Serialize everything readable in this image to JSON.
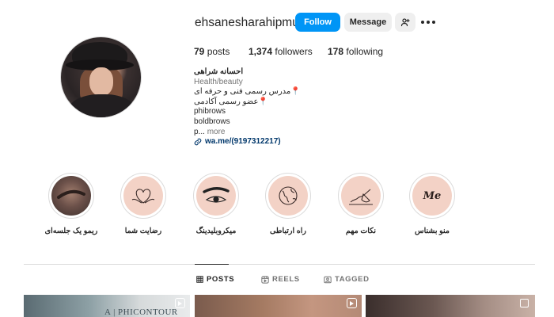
{
  "profile": {
    "username": "ehsanesharahipmu",
    "follow_label": "Follow",
    "message_label": "Message",
    "stats": {
      "posts_count": "79",
      "posts_label": "posts",
      "followers_count": "1,374",
      "followers_label": "followers",
      "following_count": "178",
      "following_label": "following"
    },
    "bio": {
      "name": "احسانه شراهی",
      "category": "Health/beauty",
      "lines": [
        "📍مدرس رسمی فنی و حرفه ای",
        "📍عضو رسمی آکادمی",
        "phibrows",
        "boldbrows"
      ],
      "truncated_text": "p...",
      "more_label": "more",
      "link": "wa.me/(9197312217)"
    }
  },
  "highlights": [
    {
      "label": "ریمو یک جلسه‌ای",
      "icon": "eyebrow-photo"
    },
    {
      "label": "رضایت شما",
      "icon": "heart-hands-icon"
    },
    {
      "label": "میکروبلیدینگ",
      "icon": "eye-brow-icon"
    },
    {
      "label": "راه ارتباطی",
      "icon": "globe-icon"
    },
    {
      "label": "نکات مهم",
      "icon": "writing-hand-icon"
    },
    {
      "label": "منو بشناس",
      "icon": "me-text",
      "text": "Me"
    }
  ],
  "tabs": [
    {
      "label": "POSTS",
      "icon": "grid-icon",
      "active": true
    },
    {
      "label": "REELS",
      "icon": "reels-icon",
      "active": false
    },
    {
      "label": "TAGGED",
      "icon": "tag-icon",
      "active": false
    }
  ],
  "posts": [
    {
      "overlay_text": "A | PHICONTOUR",
      "type": "reel"
    },
    {
      "type": "reel"
    },
    {
      "type": "carousel"
    }
  ],
  "colors": {
    "accent": "#0095f6",
    "link": "#00376b",
    "highlight_bg": "#f3d2c6"
  }
}
